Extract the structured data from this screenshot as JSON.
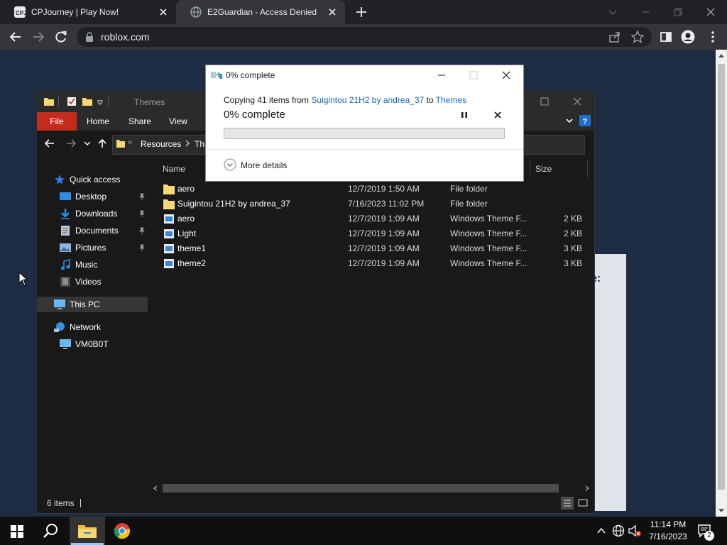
{
  "browser": {
    "tabs": [
      {
        "title": "CPJourney | Play Now!",
        "favicon": "cpj-logo-icon",
        "active": false
      },
      {
        "title": "E2Guardian - Access Denied",
        "favicon": "globe-icon",
        "active": true
      }
    ],
    "url": "roblox.com"
  },
  "page_behind": {
    "partial_text": "e:"
  },
  "explorer": {
    "title": "Themes",
    "ribbon": {
      "file": "File",
      "home": "Home",
      "share": "Share",
      "view": "View"
    },
    "address": {
      "crumb1": "Resources",
      "crumb2": "Th"
    },
    "nav": {
      "quick_access": "Quick access",
      "desktop": "Desktop",
      "downloads": "Downloads",
      "documents": "Documents",
      "pictures": "Pictures",
      "music": "Music",
      "videos": "Videos",
      "this_pc": "This PC",
      "network": "Network",
      "vm": "VM0B0T"
    },
    "columns": {
      "name": "Name",
      "size": "Size"
    },
    "rows": [
      {
        "name": "aero",
        "date": "12/7/2019 1:50 AM",
        "type": "File folder",
        "size": ""
      },
      {
        "name": "Suigintou 21H2 by andrea_37",
        "date": "7/16/2023 11:02 PM",
        "type": "File folder",
        "size": ""
      },
      {
        "name": "aero",
        "date": "12/7/2019 1:09 AM",
        "type": "Windows Theme F...",
        "size": "2 KB"
      },
      {
        "name": "Light",
        "date": "12/7/2019 1:09 AM",
        "type": "Windows Theme F...",
        "size": "2 KB"
      },
      {
        "name": "theme1",
        "date": "12/7/2019 1:09 AM",
        "type": "Windows Theme F...",
        "size": "3 KB"
      },
      {
        "name": "theme2",
        "date": "12/7/2019 1:09 AM",
        "type": "Windows Theme F...",
        "size": "3 KB"
      }
    ],
    "status": "6 items"
  },
  "copy_dialog": {
    "title": "0% complete",
    "copying_prefix": "Copying 41 items from ",
    "source": "Suigintou 21H2 by andrea_37",
    "to_word": " to ",
    "destination": "Themes",
    "percent_label": "0% complete",
    "progress": 0,
    "more_details": "More details"
  },
  "taskbar": {
    "time": "11:14 PM",
    "date": "7/16/2023",
    "notifications": "2"
  }
}
